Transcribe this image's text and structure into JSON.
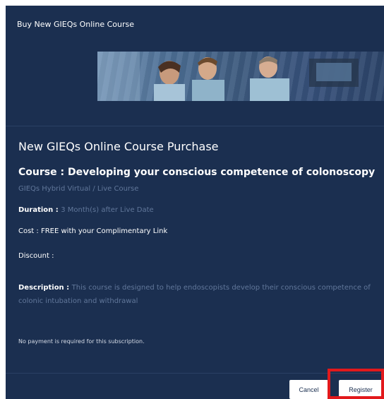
{
  "modal": {
    "header_title": "Buy New GIEQs Online Course"
  },
  "content": {
    "title": "New GIEQs Online Course Purchase",
    "course_label": "Course : ",
    "course_name": "Developing your conscious competence of colonoscopy",
    "course_type": "GIEQs Hybrid Virtual / Live Course",
    "duration_label": "Duration : ",
    "duration_value": "3 Month(s) after Live Date",
    "cost_label": "Cost : ",
    "cost_value": "FREE with your Complimentary Link",
    "discount_label": "Discount :",
    "description_label": "Description : ",
    "description_value": "This course is designed to help endoscopists develop their conscious competence of colonic intubation and withdrawal",
    "payment_note": "No payment is required for this subscription."
  },
  "buttons": {
    "cancel_label": "Cancel",
    "register_label": "Register"
  },
  "colors": {
    "modal_bg": "#1b2f50",
    "muted_text": "#61779a",
    "highlight": "#e2191c"
  }
}
